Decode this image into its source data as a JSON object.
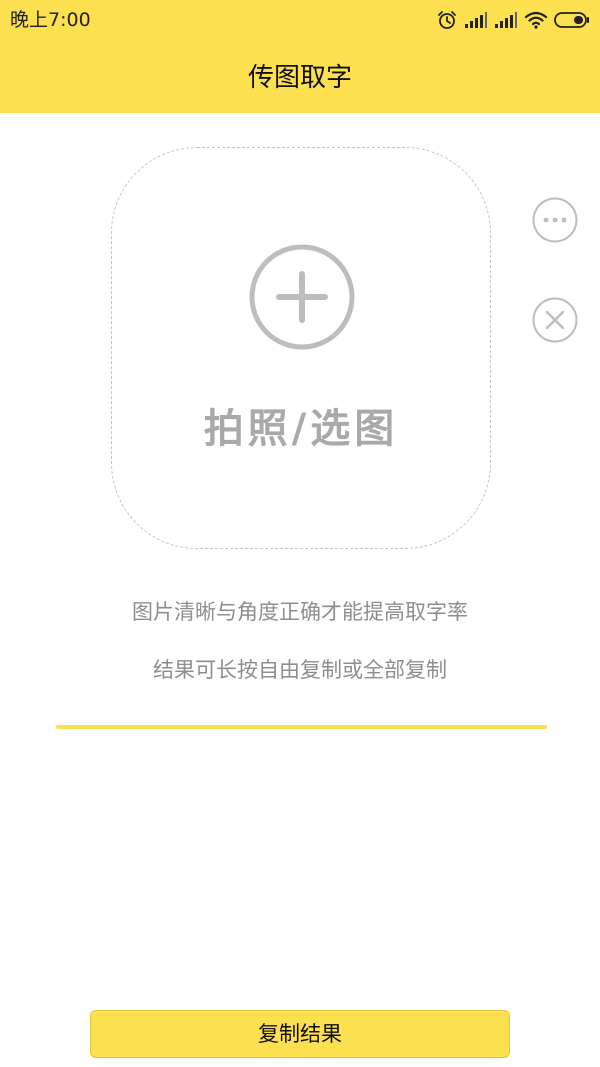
{
  "status_bar": {
    "time": "晚上7:00"
  },
  "header": {
    "title": "传图取字"
  },
  "upload": {
    "label": "拍照/选图",
    "icon": "plus-icon"
  },
  "side_actions": {
    "more_icon": "more-icon",
    "close_icon": "close-icon"
  },
  "tips": {
    "line1": "图片清晰与角度正确才能提高取字率",
    "line2": "结果可长按自由复制或全部复制"
  },
  "result": {
    "text": ""
  },
  "footer": {
    "copy_label": "复制结果"
  },
  "colors": {
    "accent": "#FCE050",
    "muted_text": "#8E8E8E",
    "dashed_border": "#C4C4C4"
  }
}
